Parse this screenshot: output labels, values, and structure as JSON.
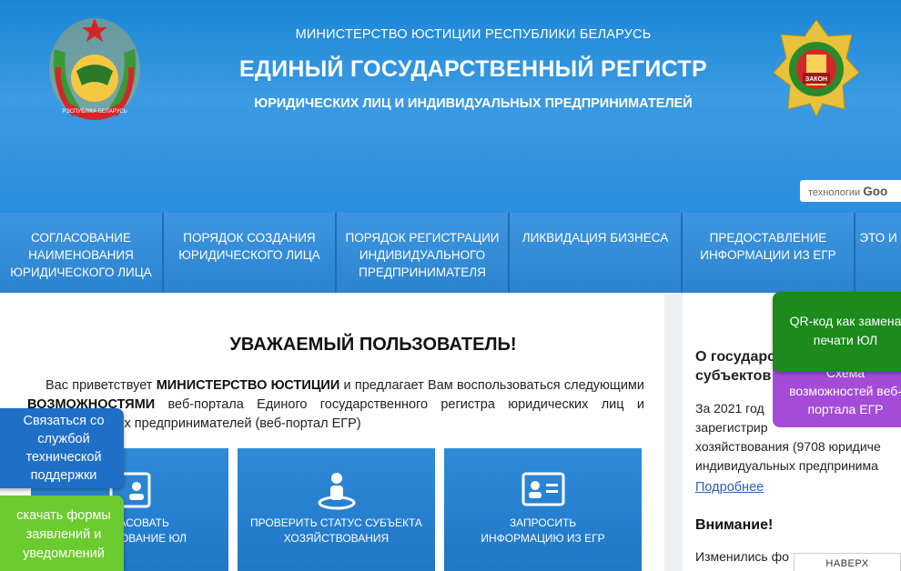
{
  "header": {
    "ministry": "МИНИСТЕРСТВО ЮСТИЦИИ РЕСПУБЛИКИ БЕЛАРУСЬ",
    "title": "ЕДИНЫЙ ГОСУДАРСТВЕННЫЙ РЕГИСТР",
    "subtitle": "ЮРИДИЧЕСКИХ ЛИЦ И ИНДИВИДУАЛЬНЫХ ПРЕДПРИНИМАТЕЛЕЙ",
    "emblem_left_text": "РЭСПУБЛІКА БЕЛАРУСЬ",
    "emblem_right_text": "ЗАКОН"
  },
  "search": {
    "label": "технологии",
    "brand": "Goo"
  },
  "nav": [
    "СОГЛАСОВАНИЕ\nНАИМЕНОВАНИЯ\nЮРИДИЧЕСКОГО ЛИЦА",
    "ПОРЯДОК СОЗДАНИЯ\nЮРИДИЧЕСКОГО ЛИЦА",
    "ПОРЯДОК РЕГИСТРАЦИИ\nИНДИВИДУАЛЬНОГО\nПРЕДПРИНИМАТЕЛЯ",
    "ЛИКВИДАЦИЯ БИЗНЕСА",
    "ПРЕДОСТАВЛЕНИЕ\nИНФОРМАЦИИ ИЗ ЕГР",
    "ЭТО И"
  ],
  "main": {
    "title": "УВАЖАЕМЫЙ ПОЛЬЗОВАТЕЛЬ!",
    "intro_1": "Вас приветствует ",
    "intro_bold_1": "МИНИСТЕРСТВО ЮСТИЦИИ",
    "intro_2": " и предлагает Вам воспользоваться следующими ",
    "intro_bold_2": "ВОЗМОЖНОСТЯМИ",
    "intro_3": " веб-портала Единого государственного регистра юридических лиц и индивидуальных предпринимателей (веб-портал ЕГР)",
    "tiles": [
      {
        "label": "СОГЛАСОВАТЬ\nНАИМЕНОВАНИЕ ЮЛ"
      },
      {
        "label": "ПРОВЕРИТЬ СТАТУС СУБЪЕКТА\nХОЗЯЙСТВОВАНИЯ"
      },
      {
        "label": "ЗАПРОСИТЬ\nИНФОРМАЦИЮ ИЗ ЕГР"
      }
    ]
  },
  "sidebar": {
    "heading": "О государс\nсубъектов",
    "paragraph": "За 2021 год\nзарегистрир\nхозяйствования (9708 юридиче\nиндивидуальных предпринима",
    "more_link": "Подробнее",
    "attention": "Внимание!",
    "changed": "Изменились фо"
  },
  "floating": {
    "qr": "QR-код как замена\nпечати ЮЛ",
    "scheme": "Схема\nвозможностей веб-\nпортала ЕГР",
    "support": "Связаться со\nслужбой\nтехнической\nподдержки",
    "forms": "скачать формы\nзаявлений и\nуведомлений",
    "up": "НАВЕРХ"
  }
}
